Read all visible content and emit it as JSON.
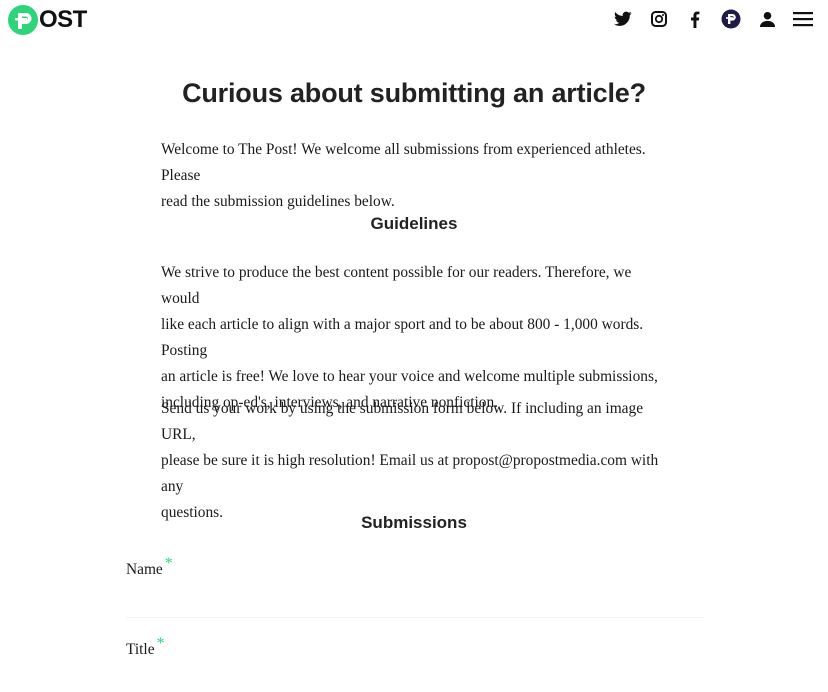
{
  "header": {
    "logo_text": "OST",
    "icons": [
      "twitter-icon",
      "instagram-icon",
      "facebook-icon",
      "propost-icon",
      "user-icon",
      "menu-icon"
    ]
  },
  "colors": {
    "brand": "#2ed47a",
    "text": "#1a1a1a",
    "propost_badge": "#1e1b4b"
  },
  "main": {
    "title": "Curious about submitting an article?",
    "intro": [
      "Welcome to The Post! We welcome all submissions from experienced athletes. Please",
      "read the submission guidelines below."
    ],
    "guidelines_heading": "Guidelines",
    "guidelines_para1": [
      "We strive to produce the best content possible for our readers. Therefore, we would",
      "like each article to align with a major sport and to be about 800 - 1,000 words. Posting",
      "an article is free! We love to hear your voice and welcome multiple submissions,",
      "including op-ed's, interviews, and narrative nonfiction."
    ],
    "guidelines_para2": [
      "Send us your work by using the submission form below. If including an image URL,",
      "please be sure it is high resolution! Email us at propost@propostmedia.com with any",
      "questions."
    ],
    "submissions_heading": "Submissions"
  },
  "form": {
    "name_label": "Name",
    "name_required": "*",
    "name_value": "",
    "title_label": "Title",
    "title_required": "*"
  }
}
